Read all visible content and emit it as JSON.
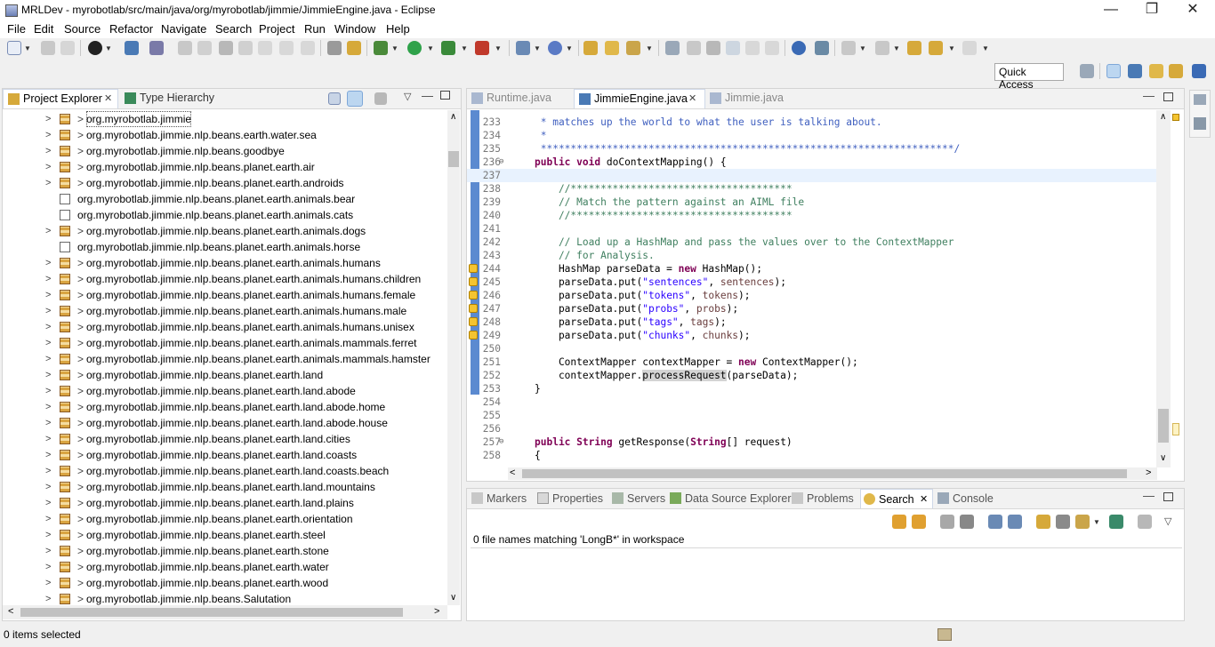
{
  "window": {
    "title": "MRLDev - myrobotlab/src/main/java/org/myrobotlab/jimmie/JimmieEngine.java - Eclipse",
    "controls": [
      "—",
      "❐",
      "✕"
    ]
  },
  "menu": [
    "File",
    "Edit",
    "Source",
    "Refactor",
    "Navigate",
    "Search",
    "Project",
    "Run",
    "Window",
    "Help"
  ],
  "toolbar": {
    "quick_access": "Quick Access"
  },
  "explorer": {
    "tabs": [
      "Project Explorer",
      "Type Hierarchy"
    ],
    "tree": [
      {
        "label": "org.myrobotlab.jimmie",
        "expandable": true,
        "marked": true
      },
      {
        "label": "org.myrobotlab.jimmie.nlp.beans.earth.water.sea",
        "expandable": true,
        "marked": true
      },
      {
        "label": "org.myrobotlab.jimmie.nlp.beans.goodbye",
        "expandable": true,
        "marked": true
      },
      {
        "label": "org.myrobotlab.jimmie.nlp.beans.planet.earth.air",
        "expandable": true,
        "marked": true
      },
      {
        "label": "org.myrobotlab.jimmie.nlp.beans.planet.earth.androids",
        "expandable": true,
        "marked": true
      },
      {
        "label": "org.myrobotlab.jimmie.nlp.beans.planet.earth.animals.bear",
        "expandable": false,
        "marked": false
      },
      {
        "label": "org.myrobotlab.jimmie.nlp.beans.planet.earth.animals.cats",
        "expandable": false,
        "marked": false
      },
      {
        "label": "org.myrobotlab.jimmie.nlp.beans.planet.earth.animals.dogs",
        "expandable": true,
        "marked": true
      },
      {
        "label": "org.myrobotlab.jimmie.nlp.beans.planet.earth.animals.horse",
        "expandable": false,
        "marked": false
      },
      {
        "label": "org.myrobotlab.jimmie.nlp.beans.planet.earth.animals.humans",
        "expandable": true,
        "marked": true
      },
      {
        "label": "org.myrobotlab.jimmie.nlp.beans.planet.earth.animals.humans.children",
        "expandable": true,
        "marked": true
      },
      {
        "label": "org.myrobotlab.jimmie.nlp.beans.planet.earth.animals.humans.female",
        "expandable": true,
        "marked": true
      },
      {
        "label": "org.myrobotlab.jimmie.nlp.beans.planet.earth.animals.humans.male",
        "expandable": true,
        "marked": true
      },
      {
        "label": "org.myrobotlab.jimmie.nlp.beans.planet.earth.animals.humans.unisex",
        "expandable": true,
        "marked": true
      },
      {
        "label": "org.myrobotlab.jimmie.nlp.beans.planet.earth.animals.mammals.ferret",
        "expandable": true,
        "marked": true
      },
      {
        "label": "org.myrobotlab.jimmie.nlp.beans.planet.earth.animals.mammals.hamster",
        "expandable": true,
        "marked": true
      },
      {
        "label": "org.myrobotlab.jimmie.nlp.beans.planet.earth.land",
        "expandable": true,
        "marked": true
      },
      {
        "label": "org.myrobotlab.jimmie.nlp.beans.planet.earth.land.abode",
        "expandable": true,
        "marked": true
      },
      {
        "label": "org.myrobotlab.jimmie.nlp.beans.planet.earth.land.abode.home",
        "expandable": true,
        "marked": true
      },
      {
        "label": "org.myrobotlab.jimmie.nlp.beans.planet.earth.land.abode.house",
        "expandable": true,
        "marked": true
      },
      {
        "label": "org.myrobotlab.jimmie.nlp.beans.planet.earth.land.cities",
        "expandable": true,
        "marked": true
      },
      {
        "label": "org.myrobotlab.jimmie.nlp.beans.planet.earth.land.coasts",
        "expandable": true,
        "marked": true
      },
      {
        "label": "org.myrobotlab.jimmie.nlp.beans.planet.earth.land.coasts.beach",
        "expandable": true,
        "marked": true
      },
      {
        "label": "org.myrobotlab.jimmie.nlp.beans.planet.earth.land.mountains",
        "expandable": true,
        "marked": true
      },
      {
        "label": "org.myrobotlab.jimmie.nlp.beans.planet.earth.land.plains",
        "expandable": true,
        "marked": true
      },
      {
        "label": "org.myrobotlab.jimmie.nlp.beans.planet.earth.orientation",
        "expandable": true,
        "marked": true
      },
      {
        "label": "org.myrobotlab.jimmie.nlp.beans.planet.earth.steel",
        "expandable": true,
        "marked": true
      },
      {
        "label": "org.myrobotlab.jimmie.nlp.beans.planet.earth.stone",
        "expandable": true,
        "marked": true
      },
      {
        "label": "org.myrobotlab.jimmie.nlp.beans.planet.earth.water",
        "expandable": true,
        "marked": true
      },
      {
        "label": "org.myrobotlab.jimmie.nlp.beans.planet.earth.wood",
        "expandable": true,
        "marked": true
      },
      {
        "label": "org.myrobotlab.jimmie.nlp.beans.Salutation",
        "expandable": true,
        "marked": true
      }
    ]
  },
  "editor": {
    "tabs": [
      "Runtime.java",
      "JimmieEngine.java",
      "Jimmie.java"
    ],
    "active_tab": "JimmieEngine.java",
    "lines": [
      {
        "n": "233",
        "text": " * matches up the world to what the user is talking about."
      },
      {
        "n": "234",
        "text": " *"
      },
      {
        "n": "235",
        "text": " *********************************************************************/"
      },
      {
        "n": "236",
        "text": "public void doContextMapping() {"
      },
      {
        "n": "237",
        "text": ""
      },
      {
        "n": "238",
        "text": "    //*************************************"
      },
      {
        "n": "239",
        "text": "    // Match the pattern against an AIML file"
      },
      {
        "n": "240",
        "text": "    //*************************************"
      },
      {
        "n": "241",
        "text": ""
      },
      {
        "n": "242",
        "text": "    // Load up a HashMap and pass the values over to the ContextMapper"
      },
      {
        "n": "243",
        "text": "    // for Analysis."
      },
      {
        "n": "244",
        "text": "    HashMap parseData = new HashMap();"
      },
      {
        "n": "245",
        "text": "    parseData.put(\"sentences\", sentences);"
      },
      {
        "n": "246",
        "text": "    parseData.put(\"tokens\", tokens);"
      },
      {
        "n": "247",
        "text": "    parseData.put(\"probs\", probs);"
      },
      {
        "n": "248",
        "text": "    parseData.put(\"tags\", tags);"
      },
      {
        "n": "249",
        "text": "    parseData.put(\"chunks\", chunks);"
      },
      {
        "n": "250",
        "text": ""
      },
      {
        "n": "251",
        "text": "    ContextMapper contextMapper = new ContextMapper();"
      },
      {
        "n": "252",
        "text": "    contextMapper.processRequest(parseData);"
      },
      {
        "n": "253",
        "text": "}"
      },
      {
        "n": "254",
        "text": ""
      },
      {
        "n": "255",
        "text": ""
      },
      {
        "n": "256",
        "text": ""
      },
      {
        "n": "257",
        "text": "public String getResponse(String[] request)"
      },
      {
        "n": "258",
        "text": "{"
      }
    ]
  },
  "bottom": {
    "tabs": [
      "Markers",
      "Properties",
      "Servers",
      "Data Source Explorer",
      "Problems",
      "Search",
      "Console"
    ],
    "active_tab": "Search",
    "result": "0 file names matching 'LongB*' in workspace"
  },
  "status": {
    "selection": "0 items selected"
  }
}
